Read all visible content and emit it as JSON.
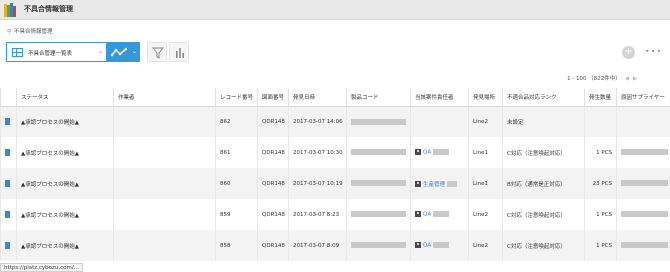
{
  "app": {
    "title": "不具合情報管理"
  },
  "breadcrumb": {
    "label": "不具合情報管理"
  },
  "toolbar": {
    "view_label": "不具合管理一覧表",
    "pager_text": "1 - 100 （822件中）",
    "add_label": "+",
    "more_label": "•••"
  },
  "table": {
    "columns": [
      "",
      "ステータス",
      "作業者",
      "レコード番号",
      "図面番号",
      "発見日時",
      "製品コード",
      "当該案件責任者",
      "発見場所",
      "不適合品対応ランク",
      "発生数量",
      "原因サプライヤー"
    ],
    "rows": [
      {
        "status": "▲承認プロセスの開始▲",
        "worker": "",
        "record": "862",
        "drawing": "QDR148",
        "datetime": "2017-03-07 14:06",
        "owner": "",
        "place": "Line2",
        "rank": "未設定",
        "qty": ""
      },
      {
        "status": "▲承認プロセスの開始▲",
        "worker": "",
        "record": "861",
        "drawing": "QDR148",
        "datetime": "2017-03-07 10:30",
        "owner": "QA",
        "place": "Line1",
        "rank": "C対応（注意喚起対応）",
        "qty": "1 PCS"
      },
      {
        "status": "▲承認プロセスの開始▲",
        "worker": "",
        "record": "860",
        "drawing": "QDR148",
        "datetime": "2017-03-07 10:19",
        "owner": "生産管理",
        "place": "Line1",
        "rank": "B対応（通常是正対応）",
        "qty": "23 PCS"
      },
      {
        "status": "▲承認プロセスの開始▲",
        "worker": "",
        "record": "859",
        "drawing": "QDR148",
        "datetime": "2017-03-07 8:23",
        "owner": "QA",
        "place": "Line2",
        "rank": "C対応（注意喚起対応）",
        "qty": "1 PCS"
      },
      {
        "status": "▲承認プロセスの開始▲",
        "worker": "",
        "record": "858",
        "drawing": "QDR148",
        "datetime": "2017-03-07 8:09",
        "owner": "QA",
        "place": "Line2",
        "rank": "C対応（注意喚起対応）",
        "qty": "1 PCS"
      }
    ]
  },
  "status_bar": {
    "url": "https://platz.cybozu.com/..."
  },
  "colors": {
    "accent": "#3498db",
    "link": "#3a7bd5",
    "row_alt": "#f3f3f3"
  }
}
